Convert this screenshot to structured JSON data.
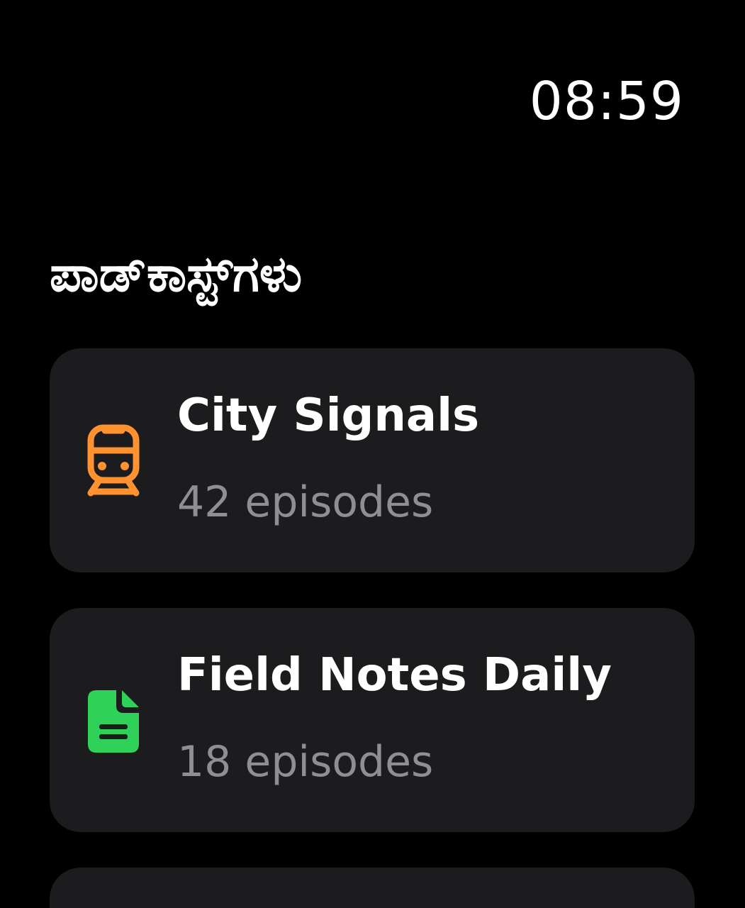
{
  "status": {
    "time": "08:59"
  },
  "header": {
    "title": "ಪಾಡ್‌ಕಾಸ್ಟ್‌ಗಳು"
  },
  "podcasts": [
    {
      "title": "City Signals",
      "episodes": "42 episodes",
      "icon": "train-icon",
      "color": "#ff9230"
    },
    {
      "title": "Field Notes Daily",
      "episodes": "18 episodes",
      "icon": "document-icon",
      "color": "#30d158"
    }
  ]
}
